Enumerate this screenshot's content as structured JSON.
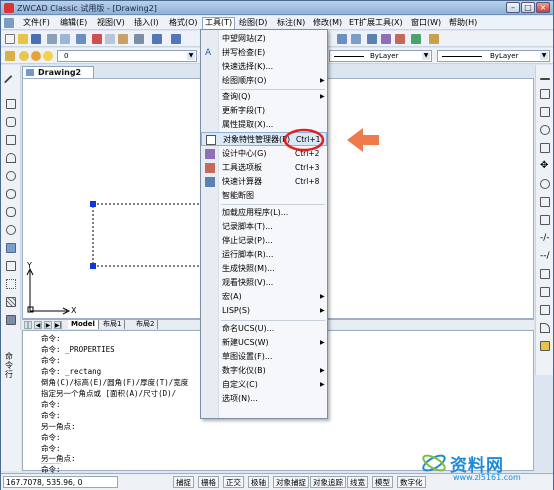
{
  "window": {
    "title": "ZWCAD Classic 试用版 - [Drawing2]"
  },
  "menubar": {
    "items": [
      "文件(F)",
      "编辑(E)",
      "视图(V)",
      "插入(I)",
      "格式(O)",
      "工具(T)",
      "绘图(D)",
      "标注(N)",
      "修改(M)",
      "ET扩展工具(X)",
      "窗口(W)",
      "帮助(H)"
    ]
  },
  "toolbar": {
    "layer_value": "0",
    "bylayer_1": "ByLayer",
    "bylayer_2": "ByLayer"
  },
  "drawing": {
    "tab": "Drawing2",
    "axis_y": "Y",
    "axis_x": "X"
  },
  "layout_tabs": [
    "Model",
    "布局1",
    "布局2"
  ],
  "tools_menu": {
    "items": [
      {
        "label": "中望网站(Z)",
        "shortcut": "",
        "arrow": false
      },
      {
        "label": "拼写检查(E)",
        "shortcut": "",
        "arrow": false
      },
      {
        "label": "快速选择(K)...",
        "shortcut": "",
        "arrow": false
      },
      {
        "label": "绘图顺序(O)",
        "shortcut": "",
        "arrow": true
      },
      {
        "label": "查询(Q)",
        "shortcut": "",
        "arrow": true
      },
      {
        "label": "更新字段(T)",
        "shortcut": "",
        "arrow": false
      },
      {
        "label": "属性提取(X)...",
        "shortcut": "",
        "arrow": false
      },
      {
        "label": "对象特性管理器(P)",
        "shortcut": "Ctrl+1",
        "arrow": false
      },
      {
        "label": "设计中心(G)",
        "shortcut": "Ctrl+2",
        "arrow": false
      },
      {
        "label": "工具选项板",
        "shortcut": "Ctrl+3",
        "arrow": false
      },
      {
        "label": "快速计算器",
        "shortcut": "Ctrl+8",
        "arrow": false
      },
      {
        "label": "智能断图",
        "shortcut": "",
        "arrow": false
      },
      {
        "label": "加载应用程序(L)...",
        "shortcut": "",
        "arrow": false
      },
      {
        "label": "记录脚本(T)...",
        "shortcut": "",
        "arrow": false
      },
      {
        "label": "停止记录(P)...",
        "shortcut": "",
        "arrow": false
      },
      {
        "label": "运行脚本(R)...",
        "shortcut": "",
        "arrow": false
      },
      {
        "label": "生成快照(M)...",
        "shortcut": "",
        "arrow": false
      },
      {
        "label": "观看快照(V)...",
        "shortcut": "",
        "arrow": false
      },
      {
        "label": "宏(A)",
        "shortcut": "",
        "arrow": true
      },
      {
        "label": "LISP(S)",
        "shortcut": "",
        "arrow": true
      },
      {
        "label": "命名UCS(U)...",
        "shortcut": "",
        "arrow": false
      },
      {
        "label": "新建UCS(W)",
        "shortcut": "",
        "arrow": true
      },
      {
        "label": "草图设置(F)...",
        "shortcut": "",
        "arrow": false
      },
      {
        "label": "数字化仪(B)",
        "shortcut": "",
        "arrow": true
      },
      {
        "label": "自定义(C)",
        "shortcut": "",
        "arrow": true
      },
      {
        "label": "选项(N)...",
        "shortcut": "",
        "arrow": false
      }
    ]
  },
  "command_window": {
    "side_label": "命令行",
    "lines": [
      "命令:",
      "命令: _PROPERTIES",
      "命令:",
      "命令: _rectang",
      "倒角(C)/标高(E)/圆角(F)/厚度(T)/宽度",
      "指定另一个角点或 [面积(A)/尺寸(D)/",
      "命令:",
      "命令:",
      "另一角点:",
      "命令:",
      "命令:",
      "另一角点:",
      "命令:"
    ]
  },
  "statusbar": {
    "coords": "167.7078,  535.96,  0",
    "buttons": [
      "捕捉",
      "栅格",
      "正交",
      "极轴",
      "对象捕捉",
      "对象追踪",
      "线宽",
      "模型",
      "数字化"
    ]
  },
  "watermark": {
    "text": "资料网",
    "url": "www.zl5161.com"
  },
  "colors": {
    "highlight_circle": "#e02020",
    "arrow": "#ef7a4a",
    "grip": "#1038d8"
  }
}
